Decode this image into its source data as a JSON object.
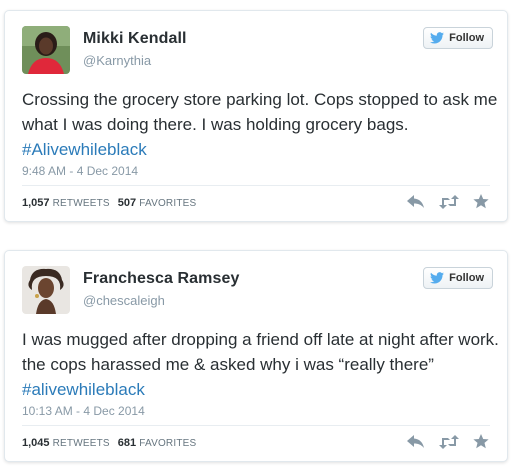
{
  "colors": {
    "hashtag": "#2b7bb9",
    "follow_bird": "#55acee",
    "muted": "#8899a6",
    "action_icon": "#8899a6"
  },
  "tweets": [
    {
      "name": "Mikki Kendall",
      "handle": "@Karnythia",
      "follow_label": "Follow",
      "text": "Crossing the grocery store parking lot. Cops stopped to ask me what I was doing there. I was holding grocery bags. ",
      "hashtag": "#Alivewhileblack",
      "date": "9:48 AM - 4 Dec 2014",
      "retweets": "1,057",
      "retweets_label": "RETWEETS",
      "favorites": "507",
      "favorites_label": "FAVORITES",
      "icons": [
        "reply-icon",
        "retweet-icon",
        "favorite-icon"
      ]
    },
    {
      "name": "Franchesca Ramsey",
      "handle": "@chescaleigh",
      "follow_label": "Follow",
      "text": "I was mugged after dropping a friend off late at night after work. the cops harassed me & asked why i was “really there” ",
      "hashtag": "#alivewhileblack",
      "date": "10:13 AM - 4 Dec 2014",
      "retweets": "1,045",
      "retweets_label": "RETWEETS",
      "favorites": "681",
      "favorites_label": "FAVORITES",
      "icons": [
        "reply-icon",
        "retweet-icon",
        "favorite-icon"
      ]
    }
  ]
}
